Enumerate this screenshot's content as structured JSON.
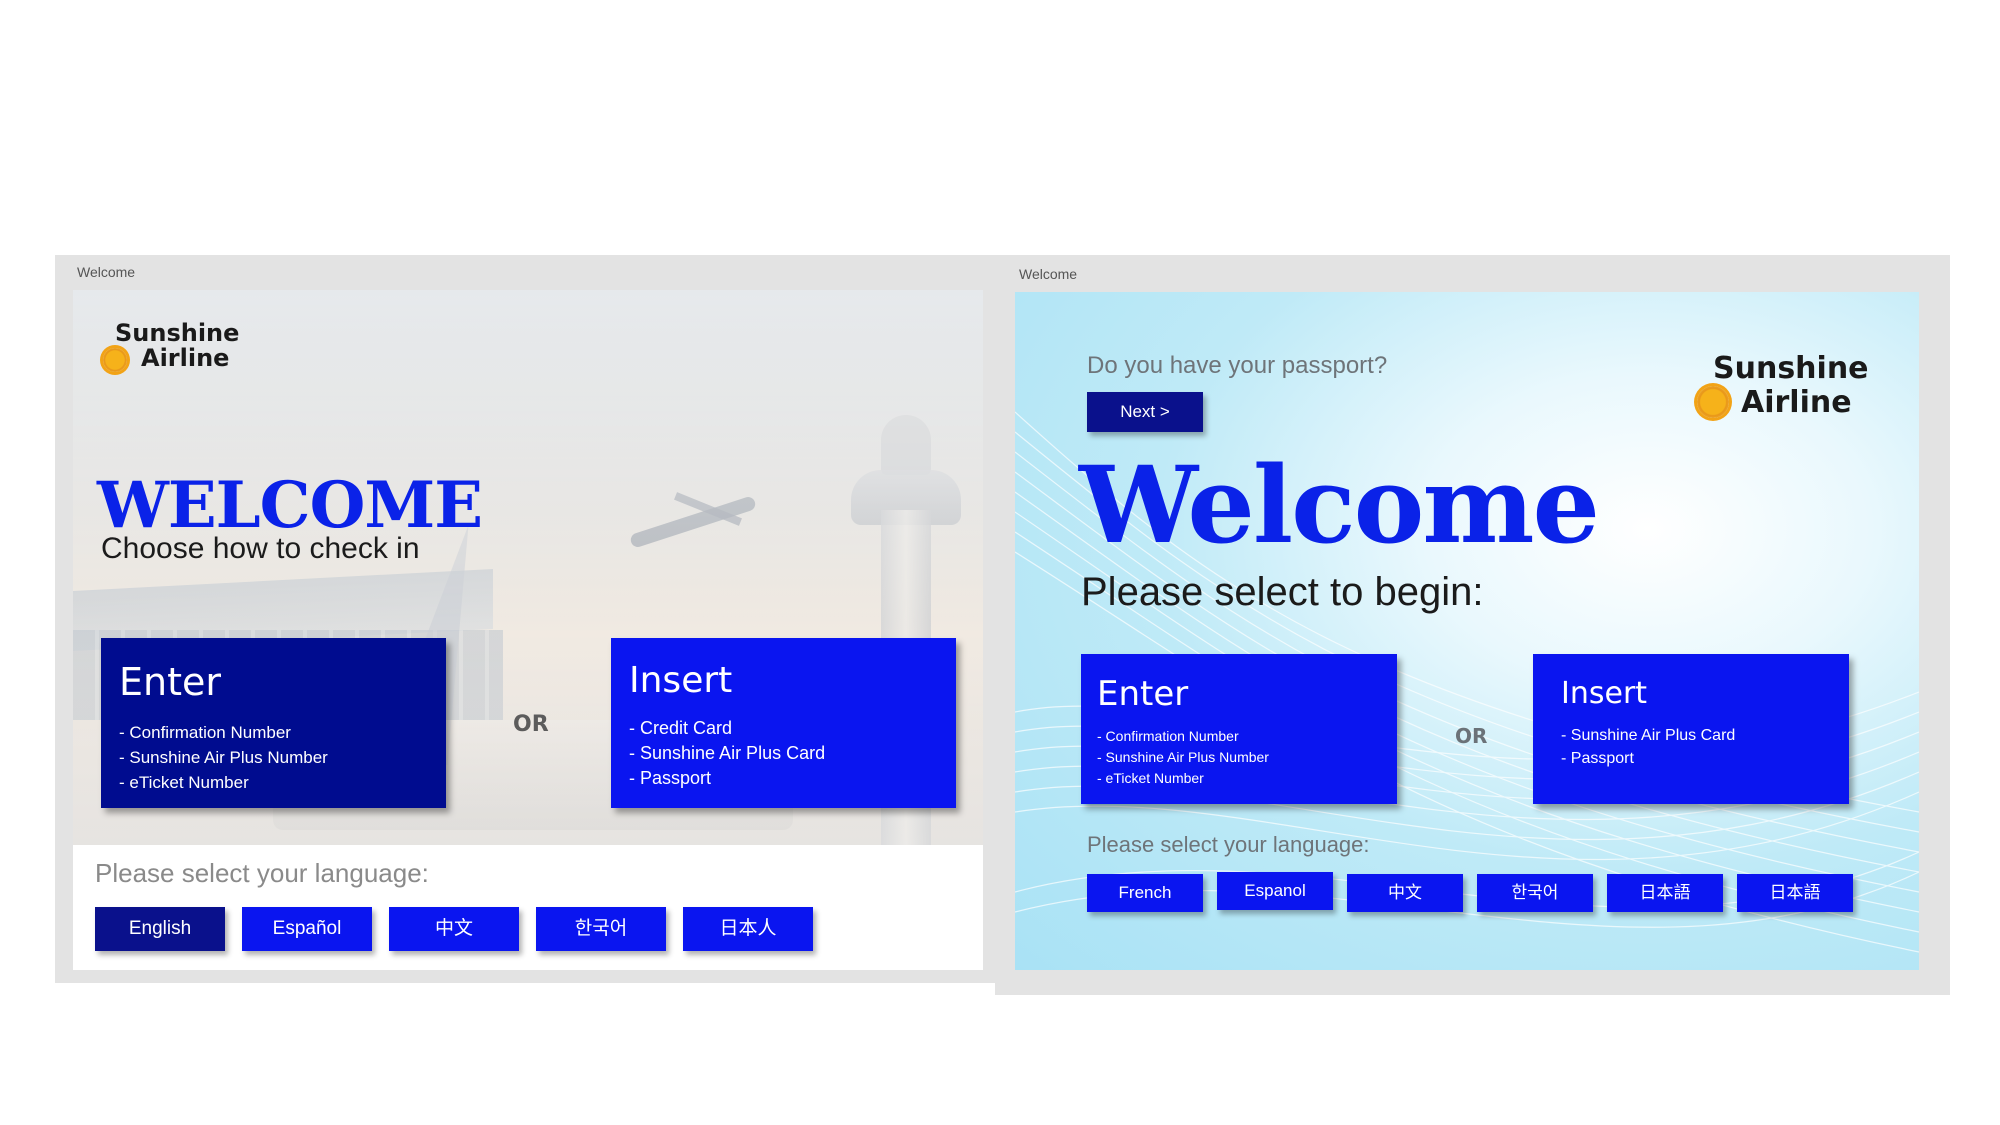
{
  "left_window": {
    "title": "Welcome",
    "logo": {
      "line1": "Sunshine",
      "line2": "Airline"
    },
    "heading": "WELCOME",
    "subtitle": "Choose how to check in",
    "enter_card": {
      "title": "Enter",
      "items": [
        "- Confirmation Number",
        "- Sunshine Air Plus Number",
        "- eTicket Number"
      ]
    },
    "or_label": "OR",
    "insert_card": {
      "title": "Insert",
      "items": [
        "- Credit Card",
        "- Sunshine Air Plus Card",
        "- Passport"
      ]
    },
    "language_prompt": "Please select your language:",
    "languages": [
      "English",
      "Español",
      "中文",
      "한국어",
      "日本人"
    ],
    "selected_language": "English"
  },
  "right_window": {
    "title": "Welcome",
    "question": "Do you have your passport?",
    "next_label": "Next >",
    "logo": {
      "line1": "Sunshine",
      "line2": "Airline"
    },
    "heading": "Welcome",
    "subtitle": "Please select to begin:",
    "enter_card": {
      "title": "Enter",
      "items": [
        "- Confirmation Number",
        "- Sunshine Air Plus Number",
        "- eTicket Number"
      ]
    },
    "or_label": "OR",
    "insert_card": {
      "title": "Insert",
      "items": [
        "- Sunshine Air Plus Card",
        "- Passport"
      ]
    },
    "language_prompt": "Please select your language:",
    "languages": [
      "French",
      "Espanol",
      "中文",
      "한국어",
      "日本語",
      "日本語"
    ]
  },
  "colors": {
    "primary_blue": "#0a15f0",
    "dark_blue": "#0a118c",
    "heading_blue": "#0a22e8",
    "sun_yellow": "#f6b21a"
  }
}
